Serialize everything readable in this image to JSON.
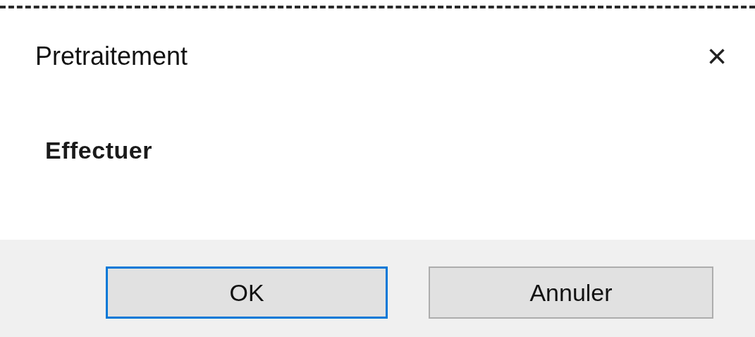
{
  "window": {
    "title": "Pretraitement",
    "close": "×"
  },
  "message": "Effectuer",
  "buttons": [
    {
      "label": "OK",
      "focused": true
    },
    {
      "label": "Annuler",
      "focused": false
    }
  ]
}
